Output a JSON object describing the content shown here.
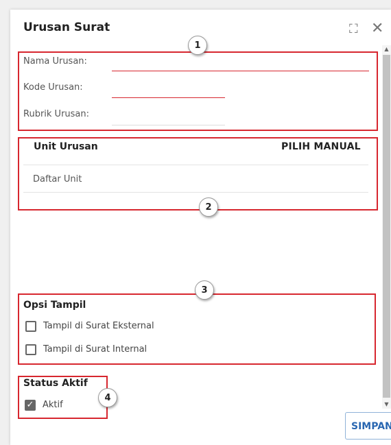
{
  "dialog": {
    "title": "Urusan Surat",
    "expand_icon": "expand-icon",
    "close_icon": "close-icon"
  },
  "fields": {
    "nama_label": "Nama Urusan:",
    "nama_value": "",
    "kode_label": "Kode Urusan:",
    "kode_value": "",
    "rubrik_label": "Rubrik Urusan:",
    "rubrik_value": ""
  },
  "unit": {
    "header": "Unit Urusan",
    "pilih_label": "PILIH MANUAL",
    "daftar_label": "Daftar Unit"
  },
  "opsi": {
    "title": "Opsi Tampil",
    "eksternal_label": "Tampil di Surat Eksternal",
    "eksternal_checked": false,
    "internal_label": "Tampil di Surat Internal",
    "internal_checked": false
  },
  "status": {
    "title": "Status Aktif",
    "aktif_label": "Aktif",
    "aktif_checked": true
  },
  "actions": {
    "simpan_label": "SIMPAN"
  },
  "annotations": {
    "badge1": "1",
    "badge2": "2",
    "badge3": "3",
    "badge4": "4"
  },
  "colors": {
    "highlight": "#d7262e",
    "primary": "#2a67b1"
  }
}
